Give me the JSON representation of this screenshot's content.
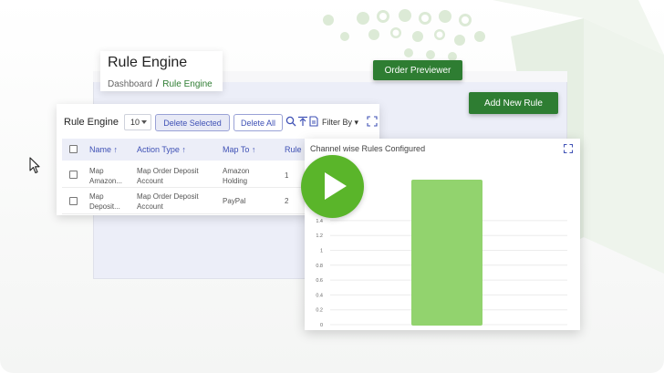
{
  "header": {
    "page_title": "Rule Engine",
    "breadcrumb": {
      "home": "Dashboard",
      "separator": "/",
      "current": "Rule Engine"
    }
  },
  "actions": {
    "order_previewer": "Order Previewer",
    "add_new_rule": "Add New Rule"
  },
  "table": {
    "title": "Rule Engine",
    "page_size": "10",
    "delete_selected": "Delete Selected",
    "delete_all": "Delete All",
    "filter_by": "Filter By",
    "icons": [
      "search-icon",
      "upload-icon",
      "document-icon",
      "expand-icon"
    ],
    "columns": {
      "name": "Name",
      "action_type": "Action Type",
      "map_to": "Map To",
      "rule": "Rule"
    },
    "sort_glyph": "↑",
    "rows": [
      {
        "name_l1": "Map",
        "name_l2": "Amazon...",
        "action_l1": "Map Order Deposit",
        "action_l2": "Account",
        "map_l1": "Amazon",
        "map_l2": "Holding",
        "rule": "1"
      },
      {
        "name_l1": "Map",
        "name_l2": "Deposit...",
        "action_l1": "Map Order Deposit",
        "action_l2": "Account",
        "map_l1": "PayPal",
        "map_l2": "",
        "rule": "2"
      }
    ]
  },
  "chart_panel": {
    "title": "Channel wise Rules Configured"
  },
  "chart_data": {
    "type": "bar",
    "title": "Channel wise Rules Configured",
    "y_ticks": [
      "1.4",
      "1.2",
      "1",
      "0.8",
      "0.6",
      "0.4",
      "0.2",
      "0"
    ],
    "ylim": [
      0,
      2
    ],
    "categories": [
      ""
    ],
    "values": [
      2
    ],
    "bar_color": "#92d36e",
    "grid": true
  },
  "colors": {
    "accent_green": "#2e7d32",
    "play_green": "#5ab52a",
    "indigo": "#3f51b5"
  }
}
